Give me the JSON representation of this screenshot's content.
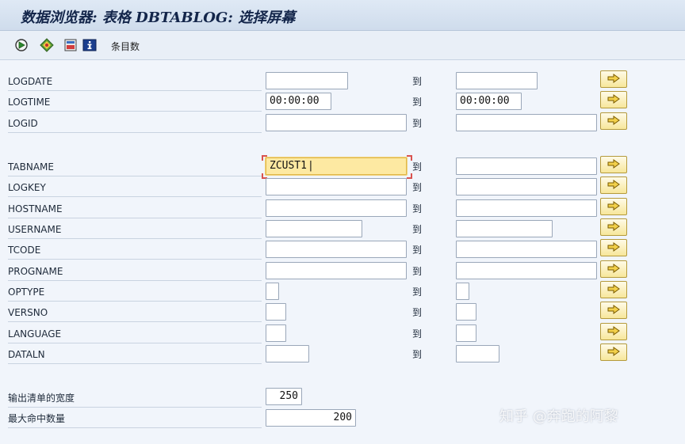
{
  "window": {
    "title": "数据浏览器: 表格 DBTABLOG: 选择屏幕"
  },
  "toolbar": {
    "icons": [
      "execute-icon",
      "dynamic-selections-icon",
      "save-variant-icon",
      "info-icon"
    ],
    "entry_count_label": "条目数"
  },
  "range_label": "到",
  "fields": [
    {
      "name": "LOGDATE",
      "low": "",
      "high": ""
    },
    {
      "name": "LOGTIME",
      "low": "00:00:00",
      "high": "00:00:00"
    },
    {
      "name": "LOGID",
      "low": "",
      "high": ""
    },
    {
      "name": "TABNAME",
      "low": "ZCUST1",
      "high": ""
    },
    {
      "name": "LOGKEY",
      "low": "",
      "high": ""
    },
    {
      "name": "HOSTNAME",
      "low": "",
      "high": ""
    },
    {
      "name": "USERNAME",
      "low": "",
      "high": ""
    },
    {
      "name": "TCODE",
      "low": "",
      "high": ""
    },
    {
      "name": "PROGNAME",
      "low": "",
      "high": ""
    },
    {
      "name": "OPTYPE",
      "low": "",
      "high": ""
    },
    {
      "name": "VERSNO",
      "low": "",
      "high": ""
    },
    {
      "name": "LANGUAGE",
      "low": "",
      "high": ""
    },
    {
      "name": "DATALN",
      "low": "",
      "high": ""
    }
  ],
  "settings": {
    "output_width_label": "输出清单的宽度",
    "output_width_value": "250",
    "max_hits_label": "最大命中数量",
    "max_hits_value": "200"
  },
  "watermark": "知乎 @奔跑的阿黎",
  "colors": {
    "focused_field": "#fde9a2",
    "multiple_selection_button": "#f7e79a",
    "title": "#13254a"
  }
}
